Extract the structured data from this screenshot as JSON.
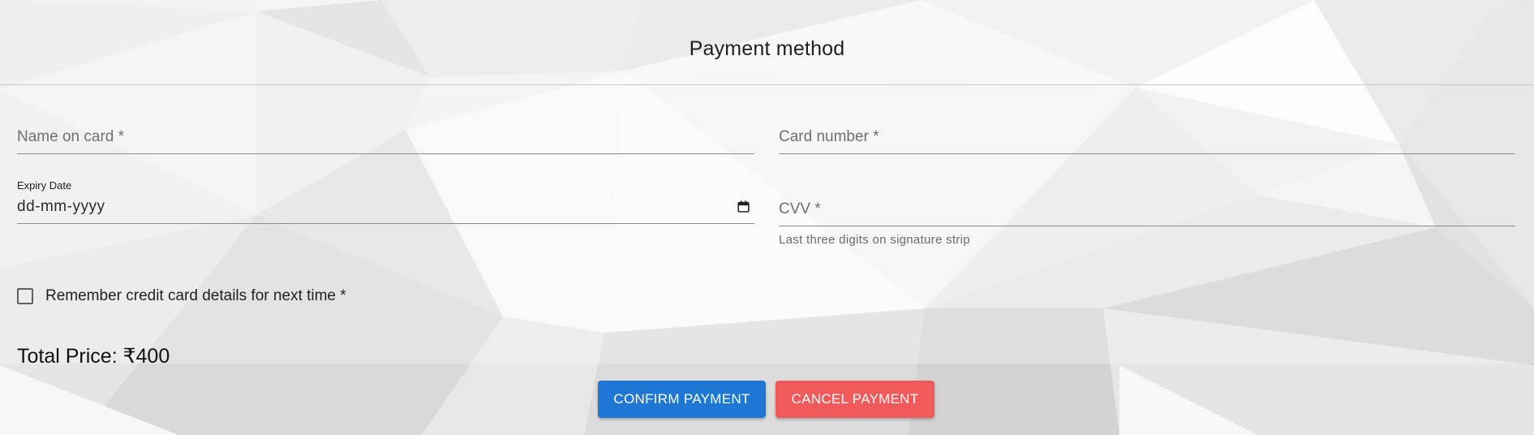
{
  "header": {
    "title": "Payment method"
  },
  "form": {
    "name_on_card": {
      "placeholder": "Name on card *",
      "value": ""
    },
    "card_number": {
      "placeholder": "Card number *",
      "value": ""
    },
    "expiry_date": {
      "label": "Expiry Date",
      "value": "dd-mm-yyyy",
      "icon": "calendar-icon"
    },
    "cvv": {
      "placeholder": "CVV *",
      "helper": "Last three digits on signature strip",
      "value": ""
    },
    "remember": {
      "label": "Remember credit card details for next time *",
      "checked": false
    }
  },
  "summary": {
    "total_label": "Total Price: ₹400"
  },
  "actions": {
    "confirm_label": "CONFIRM PAYMENT",
    "cancel_label": "CANCEL PAYMENT"
  },
  "colors": {
    "confirm": "#1e77d2",
    "cancel": "#f15a5a",
    "background": "#f4f4f4"
  }
}
